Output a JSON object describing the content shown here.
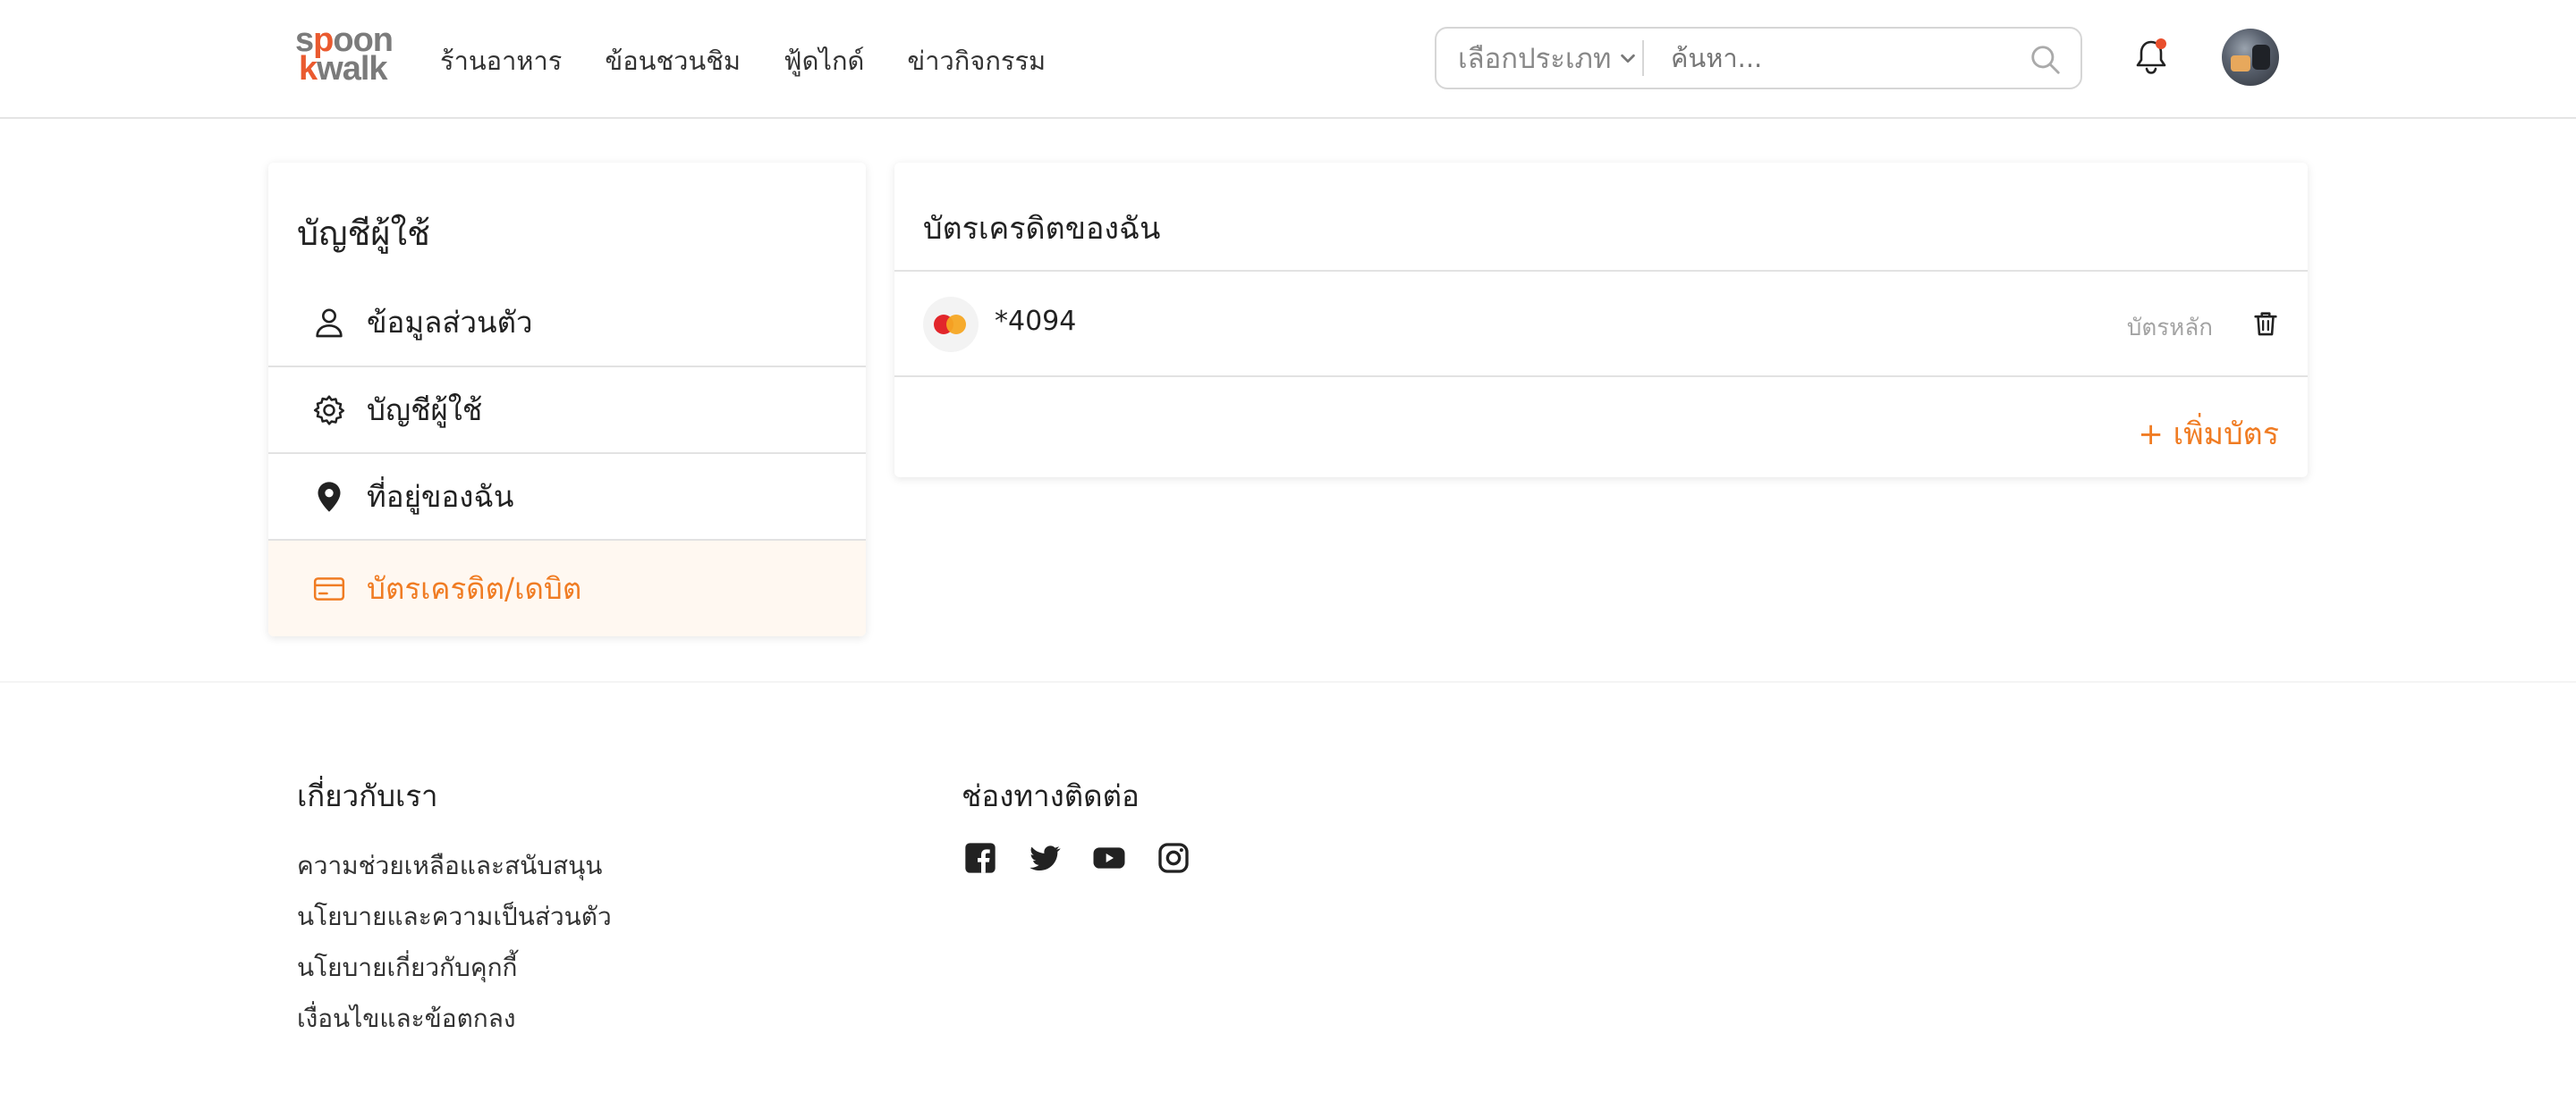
{
  "header": {
    "logo": {
      "line1_a": "s",
      "line1_b": "p",
      "line1_c": "oon",
      "line2_a": "k",
      "line2_b": "walk"
    },
    "nav": [
      "ร้านอาหาร",
      "ข้อนชวนชิม",
      "ฟู้ดไกด์",
      "ข่าวกิจกรรม"
    ],
    "search": {
      "category": "เลือกประเภท",
      "placeholder": "ค้นหา..."
    }
  },
  "sidebar": {
    "title": "บัญชีผู้ใช้",
    "items": [
      {
        "label": "ข้อมูลส่วนตัว",
        "icon": "user-icon"
      },
      {
        "label": "บัญชีผู้ใช้",
        "icon": "gear-icon"
      },
      {
        "label": "ที่อยู่ของฉัน",
        "icon": "map-pin-icon"
      },
      {
        "label": "บัตรเครดิต/เดบิต",
        "icon": "credit-card-icon",
        "active": true
      }
    ]
  },
  "cards": {
    "title": "บัตรเครดิตของฉัน",
    "list": [
      {
        "number": "*4094",
        "status": "บัตรหลัก",
        "brand_icon": "mastercard-icon"
      }
    ],
    "add_label": "+ เพิ่มบัตร"
  },
  "footer": {
    "about_title": "เกี่ยวกับเรา",
    "links": [
      "ความช่วยเหลือและสนับสนุน",
      "นโยบายและความเป็นส่วนตัว",
      "นโยบายเกี่ยวกับคุกกี้",
      "เงื่อนไขและข้อตกลง"
    ],
    "contact_title": "ช่องทางติดต่อ",
    "social": [
      "facebook-icon",
      "twitter-icon",
      "youtube-icon",
      "instagram-icon"
    ]
  },
  "colors": {
    "accent": "#f07c23",
    "logo_accent": "#ea5a2f",
    "notification_dot": "#e94e2c"
  }
}
